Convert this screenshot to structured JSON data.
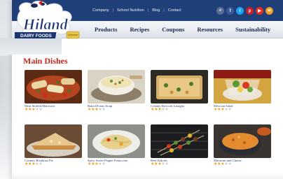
{
  "brand": {
    "name": "Hiland",
    "tagline": "DAIRY FOODS"
  },
  "top_links": [
    "Company",
    "School Nutrition",
    "Blog",
    "Contact"
  ],
  "social_icons": [
    {
      "name": "search-icon",
      "glyph": "⌕",
      "color": "#5a6f95"
    },
    {
      "name": "facebook-icon",
      "glyph": "f",
      "color": "#3b5998"
    },
    {
      "name": "twitter-icon",
      "glyph": "t",
      "color": "#1da1f2"
    },
    {
      "name": "pinterest-icon",
      "glyph": "p",
      "color": "#cb2027"
    },
    {
      "name": "youtube-icon",
      "glyph": "▶",
      "color": "#e52d27"
    },
    {
      "name": "email-icon",
      "glyph": "✉",
      "color": "#f29a1c"
    }
  ],
  "nav": [
    "Products",
    "Recipes",
    "Coupons",
    "Resources",
    "Sustainability"
  ],
  "section_title": "Main Dishes",
  "recipes": [
    {
      "name": "Meat Stuffed Manicotti",
      "rating": 3
    },
    {
      "name": "Baked Potato Soup",
      "rating": 3
    },
    {
      "name": "Creamy Broccoli Lasagna",
      "rating": 3
    },
    {
      "name": "Mexican Salad",
      "rating": 3
    },
    {
      "name": "Country Breakfast Pie",
      "rating": 3
    },
    {
      "name": "Spicy Sweet Pepper Fettuccine",
      "rating": 3
    },
    {
      "name": "Beef Kabobs",
      "rating": 3
    },
    {
      "name": "Macaroni and Cheese",
      "rating": 3
    }
  ],
  "colors": {
    "topbar": "#1e3f77",
    "title_red": "#c7291b",
    "star": "#e8a317"
  }
}
